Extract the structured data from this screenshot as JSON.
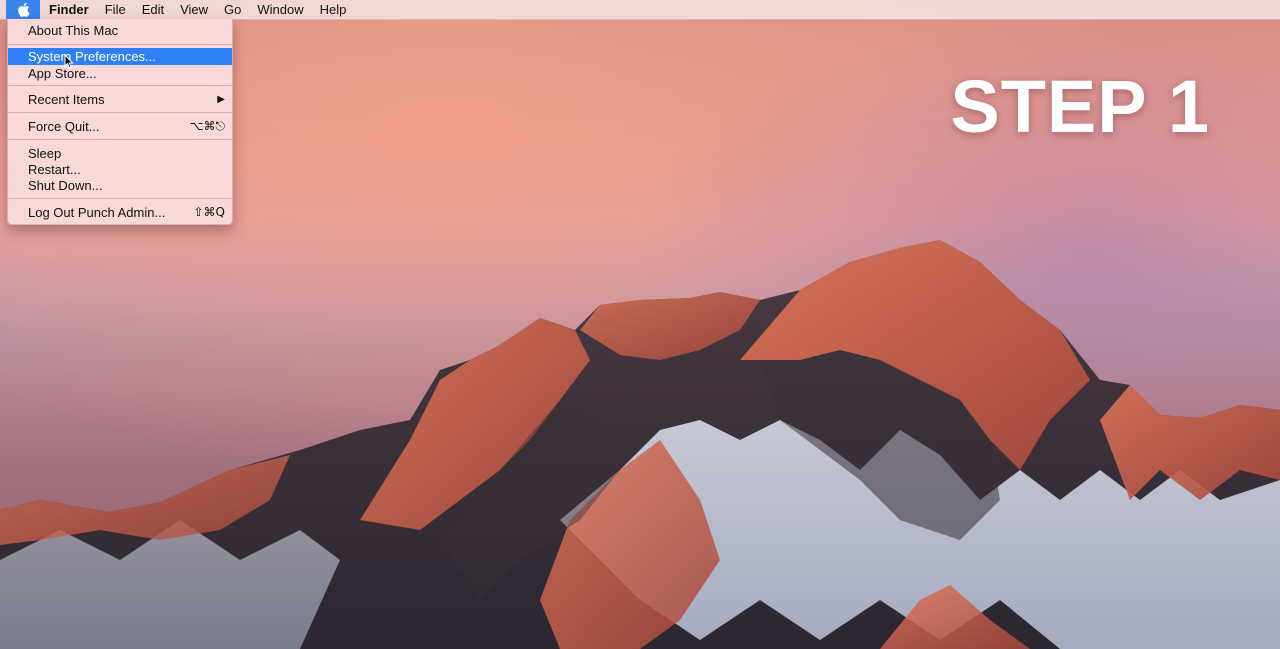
{
  "menubar": {
    "items": [
      "Finder",
      "File",
      "Edit",
      "View",
      "Go",
      "Window",
      "Help"
    ],
    "apple_icon": "apple-icon",
    "apple_active_color": "#3a84f0"
  },
  "apple_menu": {
    "about": "About This Mac",
    "system_preferences": "System Preferences...",
    "app_store": "App Store...",
    "recent_items": "Recent Items",
    "recent_items_submenu_icon": "submenu-arrow-icon",
    "force_quit": "Force Quit...",
    "force_quit_shortcut": "⌥⌘⎋",
    "sleep": "Sleep",
    "restart": "Restart...",
    "shut_down": "Shut Down...",
    "log_out": "Log Out Punch Admin...",
    "log_out_shortcut": "⇧⌘Q",
    "highlight_color": "#2f7ff5"
  },
  "overlay": {
    "step_label": "STEP 1"
  },
  "cursor_icon": "pointer-cursor-icon"
}
